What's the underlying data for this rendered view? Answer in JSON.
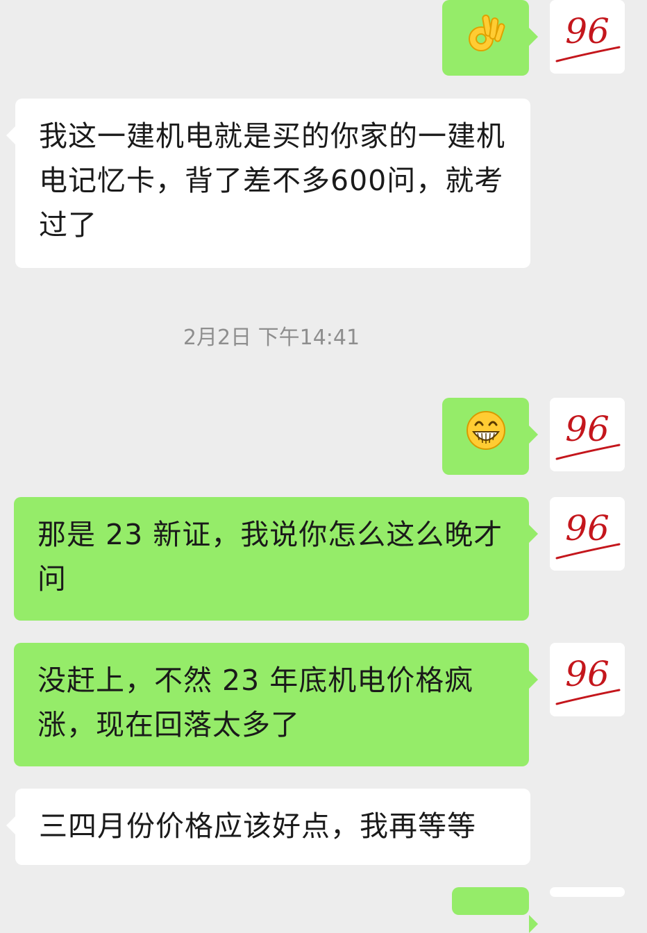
{
  "chat": {
    "timestamp": "2月2日 下午14:41",
    "messages": [
      {
        "side": "me",
        "type": "emoji",
        "emoji": "ok-hand-emoji"
      },
      {
        "side": "them",
        "type": "text",
        "text": "我这一建机电就是买的你家的一建机电记忆卡，背了差不多600问，就考过了"
      },
      {
        "side": "me",
        "type": "emoji",
        "emoji": "grin-emoji"
      },
      {
        "side": "me",
        "type": "text",
        "text": "那是 23 新证，我说你怎么这么晚才问"
      },
      {
        "side": "me",
        "type": "text",
        "text": "没赶上，不然 23 年底机电价格疯涨，现在回落太多了"
      },
      {
        "side": "them",
        "type": "text",
        "text": "三四月份价格应该好点，我再等等"
      },
      {
        "side": "me",
        "type": "partial"
      }
    ]
  },
  "avatar": {
    "label": "96",
    "ink_color": "#c4161c"
  },
  "colors": {
    "background": "#ededed",
    "my_bubble": "#95ec69",
    "their_bubble": "#ffffff",
    "timestamp": "#8e8e8e"
  }
}
